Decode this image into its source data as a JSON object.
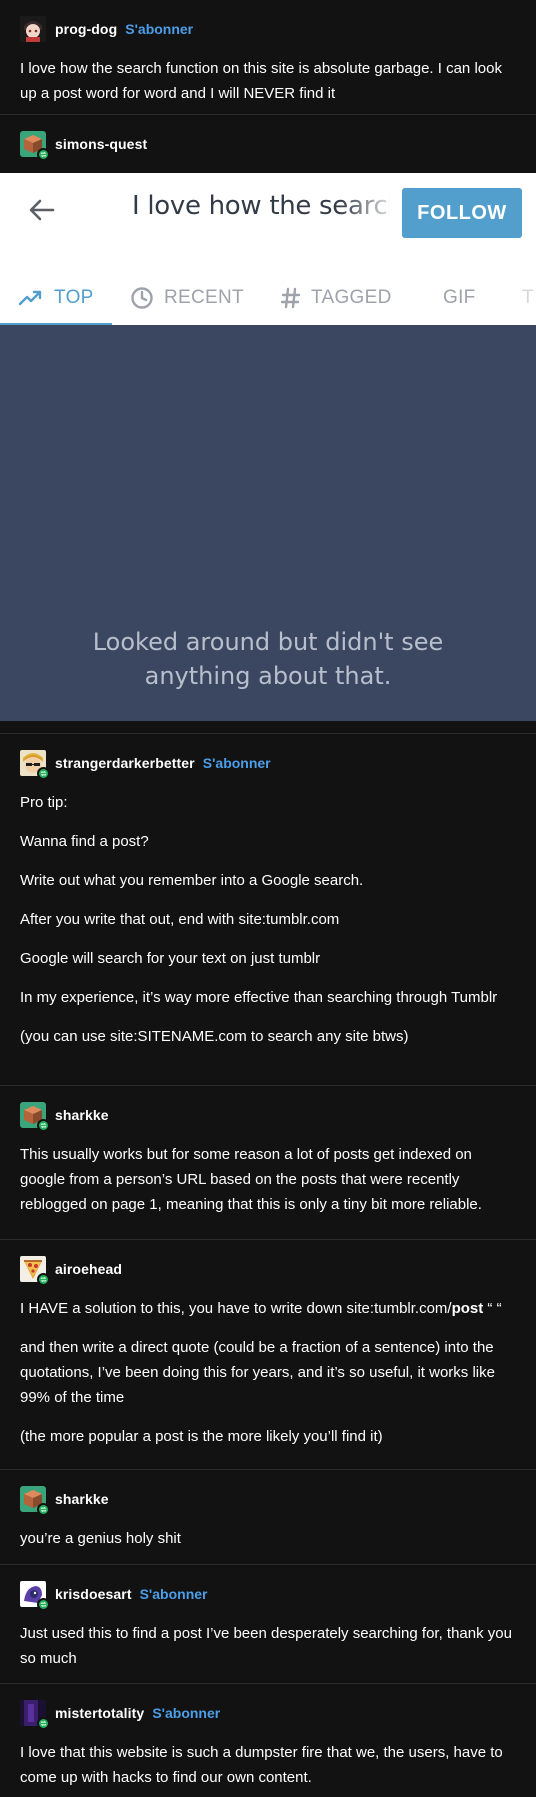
{
  "posts": [
    {
      "username": "prog-dog",
      "follow": "S'abonner",
      "paragraphs": [
        "I love how the search function on this site is absolute garbage. I can look up a post word for word and I will NEVER find it"
      ]
    },
    {
      "username": "simons-quest",
      "screenshot": {
        "search_text": "I love how the search f",
        "follow_button": "FOLLOW",
        "tabs": [
          "TOP",
          "RECENT",
          "TAGGED",
          "GIF",
          "T"
        ],
        "empty_message_line1": "Looked around but didn't see",
        "empty_message_line2": "anything about that."
      }
    },
    {
      "username": "strangerdarkerbetter",
      "follow": "S'abonner",
      "paragraphs": [
        "Pro tip:",
        "Wanna find a post?",
        "Write out what you remember into a Google search.",
        "After you write that out, end with site:tumblr.com",
        "Google will search for your text on just tumblr",
        "In my experience, it’s way more effective than searching through Tumblr",
        "(you can use site:SITENAME.com to search any site btws)"
      ]
    },
    {
      "username": "sharkke",
      "paragraphs": [
        "This usually works but for some reason a lot of posts get indexed on google from a person’s URL based on the posts that were recently reblogged on page 1, meaning that this is only a tiny bit more reliable."
      ]
    },
    {
      "username": "airoehead",
      "p1_prefix": "I HAVE a solution to this, you have to write down site:tumblr.com/",
      "p1_bold": "post",
      "p1_suffix": " “ “",
      "paragraphs": [
        "and then write a direct quote (could be a fraction of a sentence) into the quotations, I’ve been doing this for years, and it’s so useful, it works like 99% of the time",
        "(the more popular a post is the more likely you’ll find it)"
      ]
    },
    {
      "username": "sharkke",
      "paragraphs": [
        "you’re a genius holy shit"
      ]
    },
    {
      "username": "krisdoesart",
      "follow": "S'abonner",
      "paragraphs": [
        "Just used this to find a post I’ve been desperately searching for, thank you so much"
      ]
    },
    {
      "username": "mistertotality",
      "follow": "S'abonner",
      "paragraphs": [
        "I love that this website is such a dumpster fire that we, the users, have to come up with hacks to find our own content."
      ]
    }
  ],
  "icons": {
    "avatar_prog_dog": "anime-character-avatar",
    "avatar_simons_quest": "cube-avatar",
    "avatar_strangerdarkerbetter": "sunglasses-character-avatar",
    "avatar_sharkke": "cube-avatar",
    "avatar_airoehead": "pizza-avatar",
    "avatar_krisdoesart": "purple-character-avatar",
    "avatar_mistertotality": "dark-purple-avatar",
    "reblog": "reblog-icon",
    "back": "back-arrow-icon",
    "trending": "trending-icon",
    "clock": "clock-icon",
    "hash": "hash-icon"
  },
  "colors": {
    "background": "#121212",
    "accent_link": "#4c9ee8",
    "follow_button": "#529ecc",
    "empty_panel": "#3b4660"
  }
}
